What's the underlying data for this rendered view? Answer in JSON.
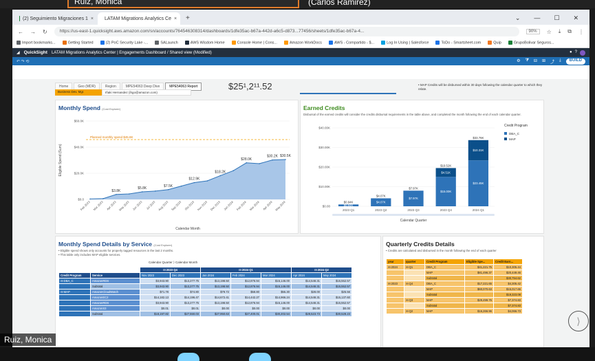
{
  "meeting": {
    "participant_top_left": "Ruiz, Monica",
    "participant_top_right": "(Carlos Ramirez)",
    "participant_bottom": "Ruiz, Monica"
  },
  "browser": {
    "tabs": [
      {
        "label": "(2) Seguimiento Migraciones 1",
        "color": "#188038"
      },
      {
        "label": "LATAM Migrations Analytics Ce",
        "color": "#1a73e8"
      }
    ],
    "new_tab": "+",
    "url": "https://us-east-1.quicksight.aws.amazon.com/sn/accounts/764546308314/dashboards/1dfe35ac-b67a-442d-a6c5-d873...77456/sheets/1dfe35ac-b67a-4...",
    "zoom": "90%",
    "bookmarks": [
      {
        "label": "Import bookmarks...",
        "color": "#5f6368"
      },
      {
        "label": "Getting Started",
        "color": "#e8710a"
      },
      {
        "label": "(2) PoC Security Lake -...",
        "color": "#1a73e8"
      },
      {
        "label": "SALaunch",
        "color": "#5f6368"
      },
      {
        "label": "AWS Wisdom Home",
        "color": "#232f3e"
      },
      {
        "label": "Console Home | Cons...",
        "color": "#ff9900"
      },
      {
        "label": "Amazon WorkDocs",
        "color": "#ff9900"
      },
      {
        "label": "AWS - Compartido - $...",
        "color": "#1a73e8"
      },
      {
        "label": "Log In Using | Salesforce",
        "color": "#00a1e0"
      },
      {
        "label": "ToDo - Smartsheet.com",
        "color": "#1a73e8"
      },
      {
        "label": "Quip",
        "color": "#f27a24"
      },
      {
        "label": "GrupoBolivar Seguros...",
        "color": "#188038"
      }
    ]
  },
  "quicksight": {
    "logo": "QuickSight",
    "breadcrumb": "LATAM Migrations Analytics Center | Engagements Dashboard / Shared view (Modified)",
    "build_label": "BUILD",
    "sheet_tabs": [
      "Home",
      "Geo (MDR)",
      "Region",
      "MPE54063 Deep Dive",
      "MPE54063 Report"
    ],
    "active_sheet_index": 4,
    "bdm_label": "Business Dev. Mgr.",
    "bdm_value": "Iñaki Hernandez (ihgo@amazon.com)",
    "top_number": "$25¹,2¹¹.52",
    "top_bullet": "MAP Credits will be disbursed within 30 days following the calendar quarter to which they relate."
  },
  "monthly_spend": {
    "title": "Monthly Spend",
    "title_small": "(Cost Explorer)",
    "planned_label": "Planned monthly spend $45.8K",
    "chart_data": {
      "type": "area",
      "title": "Monthly Spend",
      "xlabel": "Calendar Month",
      "ylabel": "Eligible Spend (Sum)",
      "categories": [
        "Feb 2023",
        "Mar 2023",
        "Apr 2023",
        "May 2023",
        "Jun 2023",
        "Jul 2023",
        "Aug 2023",
        "Sep 2023",
        "Oct 2023",
        "Nov 2023",
        "Dec 2023",
        "Jan 2024",
        "Feb 2024",
        "Mar 2024",
        "Apr 2024",
        "May 2024"
      ],
      "values": [
        0.3,
        0.6,
        3.8,
        4.2,
        5.8,
        6.4,
        7.5,
        10.2,
        12.9,
        14.2,
        18.2,
        22.0,
        28.0,
        27.4,
        30.2,
        30.5
      ],
      "data_labels": [
        {
          "index": 2,
          "text": "$3.8K"
        },
        {
          "index": 4,
          "text": "$5.8K"
        },
        {
          "index": 6,
          "text": "$7.5K"
        },
        {
          "index": 8,
          "text": "$12.9K"
        },
        {
          "index": 10,
          "text": "$18.2K"
        },
        {
          "index": 12,
          "text": "$28.0K"
        },
        {
          "index": 14,
          "text": "$30.2K"
        },
        {
          "index": 15,
          "text": "$30.5K"
        }
      ],
      "planned": 45.8,
      "yticks": [
        "$0.0",
        "$20.0K",
        "$40.0K",
        "$60.0K"
      ],
      "ylim": [
        0,
        60
      ],
      "series_color": "#2e73b8"
    }
  },
  "earned_credits": {
    "title": "Earned Credits",
    "note": "Disbursal of the earned credits will consider the credits disbursal requirements in the table above, and completed the month following the end of each calendar quarter.",
    "legend_title": "Credit Program",
    "chart_data": {
      "type": "bar",
      "title": "Earned Credits",
      "xlabel": "Calendar Quarter",
      "categories": [
        "2023 Q1",
        "2023 Q2",
        "2023 Q3",
        "2023 Q4",
        "2024 Q1"
      ],
      "series": [
        {
          "name": "DBA_C",
          "color": "#2e73b8",
          "values": [
            0.94,
            4.07,
            7.97,
            15.0,
            23.45
          ]
        },
        {
          "name": "MAP",
          "color": "#0b4f8a",
          "values": [
            0.0,
            0.0,
            0.0,
            4.51,
            10.31
          ]
        }
      ],
      "totals": [
        0.94,
        4.07,
        7.97,
        19.52,
        33.76
      ],
      "total_labels": [
        "$0.94K",
        "$4.07K",
        "$7.97K",
        "$19.52K",
        "$33.76K"
      ],
      "segment_labels": [
        [
          "$0.94K",
          ""
        ],
        [
          "$4.07K",
          ""
        ],
        [
          "$7.97K",
          ""
        ],
        [
          "$15.00K",
          "$4.51K"
        ],
        [
          "$23.45K",
          "$10.31K"
        ]
      ],
      "yticks": [
        "$0.00",
        "$10.00K",
        "$20.00K",
        "$30.00K",
        "$40.00K"
      ],
      "ylim": [
        0,
        40
      ]
    }
  },
  "spend_details": {
    "title": "Monthly Spend Details by Service",
    "title_small": "(Cost Explorer)",
    "bullets": [
      "Eligible spend shows only accounts for properly tagged resources in the last 2 months.",
      "This table only includes MAP eligible services."
    ],
    "pivot_rows_label": "Calendar Quarter",
    "pivot_cols_label": "Calendar Month",
    "quarters": [
      "2023 Q4",
      "2024 Q1",
      "2024 Q2"
    ],
    "row_headers": [
      "Credit Program",
      "Service"
    ],
    "months": [
      "Nov 2023",
      "Dec 2023",
      "Jan 2024",
      "Feb 2024",
      "Mar 2024",
      "Apr 2024",
      "May 2024"
    ],
    "rows": [
      {
        "program": "DBA_C",
        "service": "AmazonRDS",
        "style": "program",
        "vals": [
          "$3,943.90",
          "$13,277.75",
          "$13,198.50",
          "$12,876.94",
          "$15,146.00",
          "$14,548.31",
          "$15,552.57"
        ]
      },
      {
        "program": "",
        "service": "Subtotal",
        "style": "sub",
        "vals": [
          "$3,943.90",
          "$13,277.75",
          "$13,198.50",
          "$12,876.94",
          "$15,146.00",
          "$14,548.31",
          "$15,552.57"
        ]
      },
      {
        "program": "MAP",
        "service": "AmazonCloudWatch",
        "style": "program",
        "vals": [
          "$71.78",
          "$74.80",
          "$79.72",
          "$58.80",
          "$55.30",
          "$28.00",
          "$25.56"
        ]
      },
      {
        "program": "",
        "service": "AmazonEC2",
        "style": "row",
        "vals": [
          "$14,182.13",
          "$14,196.47",
          "$14,672.41",
          "$14,442.27",
          "$14,966.24",
          "$14,548.31",
          "$15,137.60"
        ]
      },
      {
        "program": "",
        "service": "AmazonRDS",
        "style": "row",
        "vals": [
          "$3,943.90",
          "$13,277.75",
          "$13,198.50",
          "$12,876.94",
          "$15,146.00",
          "$14,548.31",
          "$15,552.57"
        ]
      },
      {
        "program": "",
        "service": "AmazonS3",
        "style": "row",
        "vals": [
          "$0.01",
          "$0.01",
          "$0.00",
          "$0.00",
          "$0.00",
          "$0.00",
          "$0.00"
        ]
      },
      {
        "program": "",
        "service": "Subtotal",
        "style": "sub",
        "vals": [
          "$18,197.82",
          "$27,550.03",
          "$27,950.63",
          "$27,400.01",
          "$30,202.54",
          "$28,523.73",
          "$30,528.23"
        ]
      }
    ]
  },
  "quarterly_credits": {
    "title": "Quarterly Credits Details",
    "note": "Credits are calculated and disbursed in the month following the end of each quarter",
    "headers": [
      "year",
      "quarter",
      "Credit Program",
      "Eligible Spe...",
      "Credit Earn..."
    ],
    "rows": [
      {
        "year": "2024",
        "quarter": "Q1",
        "program": "DBA_C",
        "spend": "$41,221.75",
        "credit": "$10,305.44",
        "style": "row"
      },
      {
        "year": "",
        "quarter": "",
        "program": "MAP",
        "spend": "$81,496.37",
        "credit": "$20,449.46",
        "style": "row"
      },
      {
        "year": "",
        "quarter": "",
        "program": "Subtotal",
        "spend": "",
        "credit": "$30,754.62",
        "style": "sub"
      },
      {
        "year": "2023",
        "quarter": "Q4",
        "program": "DBA_C",
        "spend": "$17,221.65",
        "credit": "$4,305.42",
        "style": "row"
      },
      {
        "year": "",
        "quarter": "",
        "program": "MAP",
        "spend": "$60,070.63",
        "credit": "$15,017.66",
        "style": "row"
      },
      {
        "year": "",
        "quarter": "",
        "program": "Subtotal",
        "spend": "",
        "credit": "$19,323.08",
        "style": "sub"
      },
      {
        "year": "",
        "quarter": "Q3",
        "program": "MAP",
        "spend": "$29,499.76",
        "credit": "$7,374.83",
        "style": "row"
      },
      {
        "year": "",
        "quarter": "",
        "program": "Subtotal",
        "spend": "",
        "credit": "$7,374.83",
        "style": "sub"
      },
      {
        "year": "",
        "quarter": "Q2",
        "program": "MAP",
        "spend": "$16,266.96",
        "credit": "$4,066.73",
        "style": "row"
      }
    ]
  }
}
